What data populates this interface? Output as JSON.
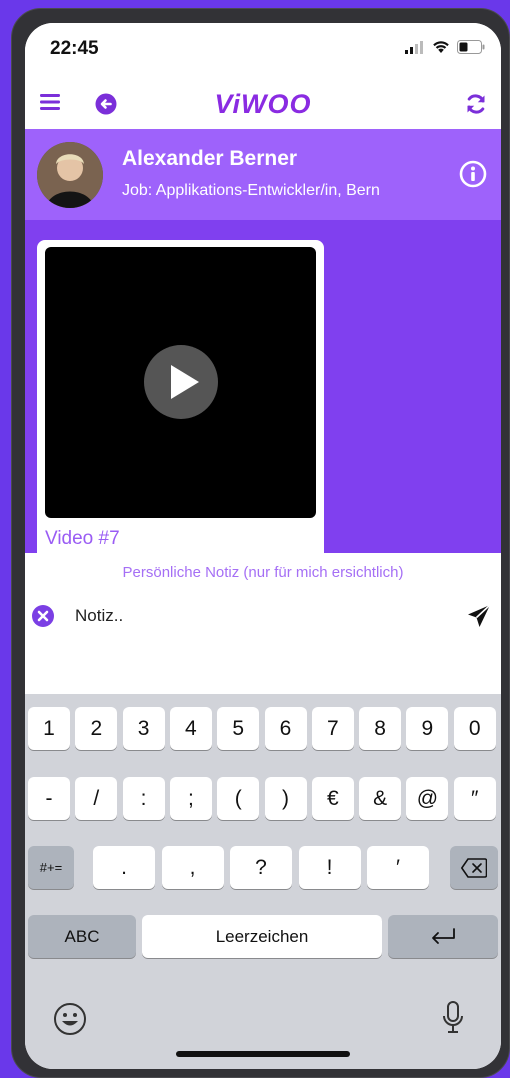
{
  "status_bar": {
    "time": "22:45"
  },
  "nav": {
    "logo": "ViWOO",
    "menu_icon": "menu-icon",
    "back_icon": "back-arrow-circle-icon",
    "refresh_icon": "refresh-icon"
  },
  "profile": {
    "name": "Alexander Berner",
    "job": "Job: Applikations-Entwickler/in, Bern",
    "info_icon": "info-icon"
  },
  "video": {
    "label": "Video #7",
    "play_icon": "play-icon"
  },
  "note": {
    "header": "Persönliche Notiz (nur für mich ersichtlich)",
    "value": "Notiz..",
    "clear_icon": "clear-icon",
    "send_icon": "send-icon"
  },
  "keyboard": {
    "row1": [
      "1",
      "2",
      "3",
      "4",
      "5",
      "6",
      "7",
      "8",
      "9",
      "0"
    ],
    "row2": [
      "-",
      "/",
      ":",
      ";",
      "(",
      ")",
      "€",
      "&",
      "@",
      "″"
    ],
    "row3_left": "#+=",
    "row3": [
      ".",
      ",",
      "?",
      "!",
      "′"
    ],
    "backspace_icon": "backspace-icon",
    "abc": "ABC",
    "space": "Leerzeichen",
    "return_icon": "return-icon",
    "emoji_icon": "emoji-icon",
    "mic_icon": "microphone-icon"
  },
  "colors": {
    "brand": "#8a2be2",
    "profile_bg": "#9e62fb",
    "content_bg": "#8040ef",
    "accent_text": "#a56ff5"
  }
}
